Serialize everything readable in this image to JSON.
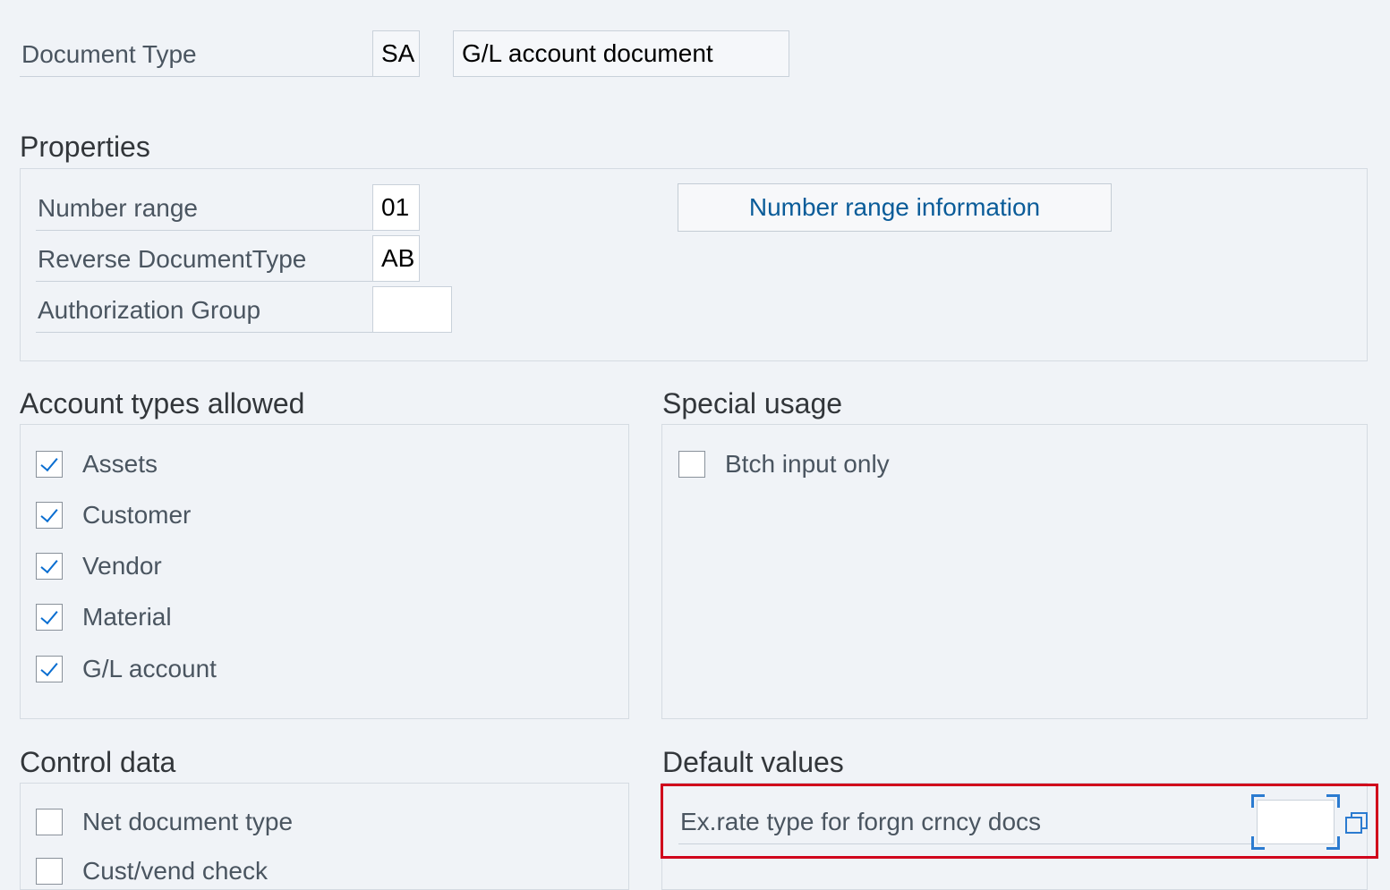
{
  "header": {
    "doc_type_label": "Document Type",
    "doc_type_code": "SA",
    "doc_type_desc": "G/L account document"
  },
  "properties": {
    "title": "Properties",
    "number_range_label": "Number range",
    "number_range_value": "01",
    "reverse_doc_type_label": "Reverse DocumentType",
    "reverse_doc_type_value": "AB",
    "auth_group_label": "Authorization Group",
    "auth_group_value": "",
    "number_range_info_button": "Number range information"
  },
  "account_types": {
    "title": "Account types allowed",
    "items": [
      {
        "label": "Assets",
        "checked": true
      },
      {
        "label": "Customer",
        "checked": true
      },
      {
        "label": "Vendor",
        "checked": true
      },
      {
        "label": "Material",
        "checked": true
      },
      {
        "label": "G/L account",
        "checked": true
      }
    ]
  },
  "special_usage": {
    "title": "Special usage",
    "items": [
      {
        "label": "Btch input only",
        "checked": false
      }
    ]
  },
  "control_data": {
    "title": "Control data",
    "items": [
      {
        "label": "Net document type",
        "checked": false
      },
      {
        "label": "Cust/vend check",
        "checked": false
      }
    ]
  },
  "default_values": {
    "title": "Default values",
    "ex_rate_label": "Ex.rate type for forgn crncy docs",
    "ex_rate_value": ""
  },
  "colors": {
    "background": "#f0f3f7",
    "highlight": "#d0021b",
    "accent": "#0a6ed1",
    "link_text": "#0a5c99"
  }
}
